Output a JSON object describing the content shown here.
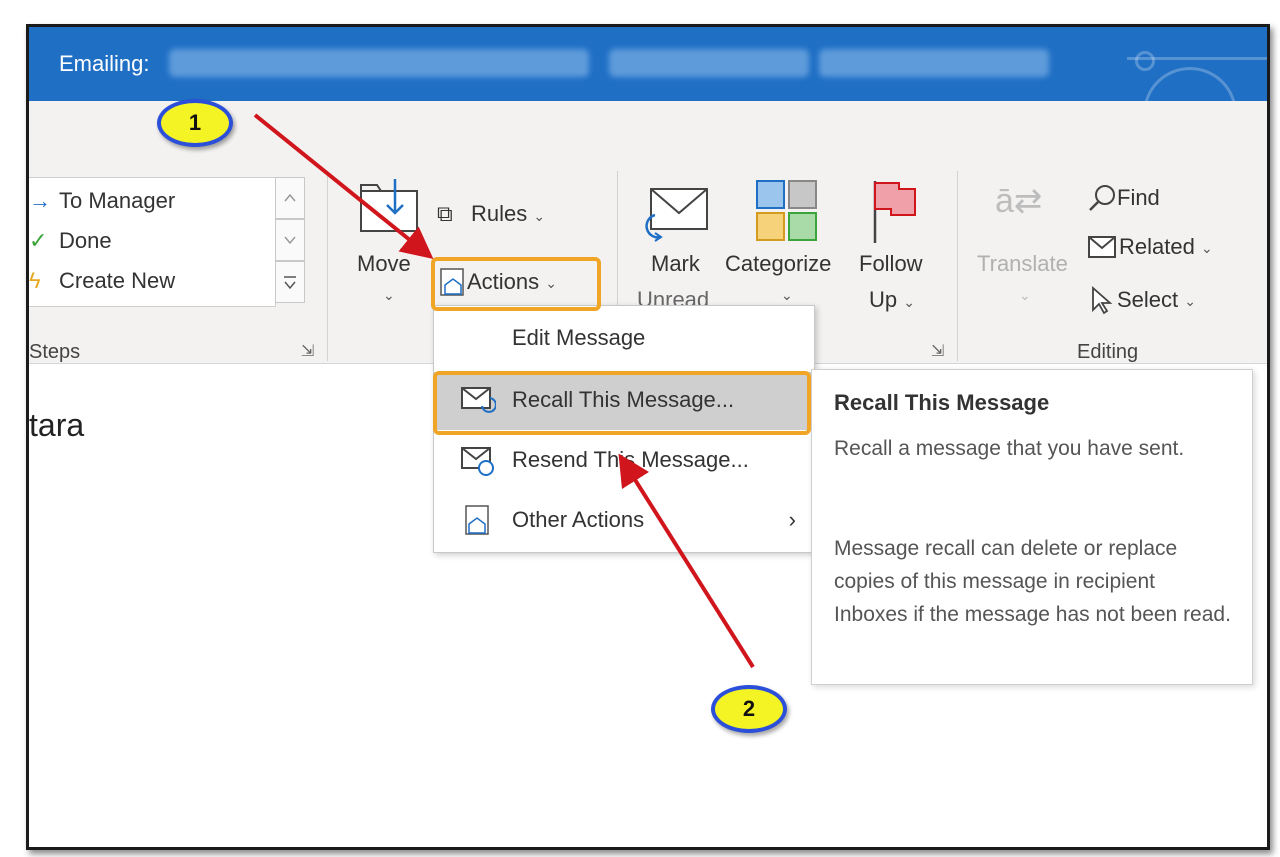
{
  "titlebar": {
    "label": "Emailing:"
  },
  "quick_steps": {
    "items": [
      {
        "label": "To Manager",
        "icon": "arrow-right-icon"
      },
      {
        "label": "Done",
        "icon": "check-icon"
      },
      {
        "label": "Create New",
        "icon": "lightning-icon"
      }
    ],
    "group_label": "Steps"
  },
  "move_group": {
    "move_label": "Move",
    "rules_label": "Rules",
    "actions_label": "Actions"
  },
  "tags_group": {
    "mark_label_1": "Mark",
    "mark_label_2": "Unread",
    "categorize_label": "Categorize",
    "follow_label_1": "Follow",
    "follow_label_2": "Up"
  },
  "editing_group": {
    "translate_label": "Translate",
    "find_label": "Find",
    "related_label": "Related",
    "select_label": "Select",
    "group_label": "Editing"
  },
  "content": {
    "partial_text": "tara"
  },
  "actions_menu": {
    "items": [
      {
        "label": "Edit Message"
      },
      {
        "label": "Recall This Message..."
      },
      {
        "label": "Resend This Message..."
      },
      {
        "label": "Other Actions"
      }
    ]
  },
  "tooltip": {
    "title": "Recall This Message",
    "description": "Recall a message that you have sent.",
    "details": "Message recall can delete or replace copies of this message in recipient Inboxes if the message has not been read."
  },
  "callouts": {
    "one": "1",
    "two": "2"
  },
  "colors": {
    "titlebar": "#1f6fc5",
    "highlight": "#f0a526",
    "arrow": "#d0151c",
    "callout_fill": "#f4f425",
    "callout_border": "#2b4fd8"
  }
}
